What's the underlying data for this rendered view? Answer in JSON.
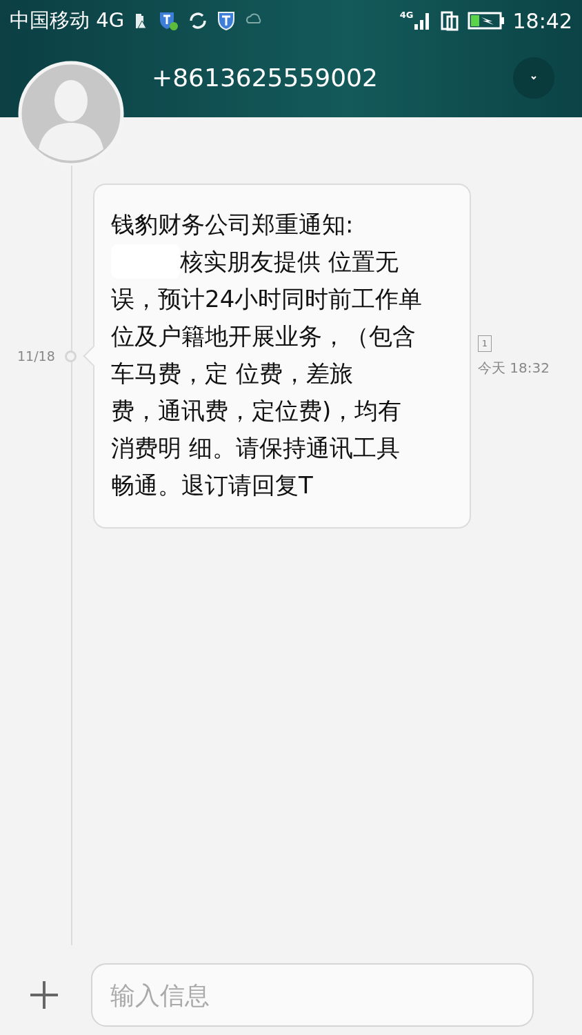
{
  "status_bar": {
    "carrier": "中国移动 4G",
    "network": "4G",
    "time": "18:42"
  },
  "header": {
    "contact": "+8613625559002"
  },
  "thread": {
    "date": "11/18",
    "message": {
      "lines": [
        {
          "text": "钱豹财务公司郑重通知:",
          "redacted": false
        },
        {
          "text": "核实朋友提供 位置无",
          "redacted": true
        },
        {
          "text": "误，预计24小时同时前工作单",
          "redacted": false
        },
        {
          "text": "位及户籍地开展业务，（包含",
          "redacted": false
        },
        {
          "text": "车马费，定 位费，差旅",
          "redacted": false
        },
        {
          "text": "费，通讯费，定位费)，均有",
          "redacted": false
        },
        {
          "text": "消费明 细。请保持通讯工具",
          "redacted": false
        },
        {
          "text": "畅通。退订请回复T",
          "redacted": false
        }
      ],
      "sim": "1",
      "time": "今天 18:32"
    }
  },
  "composer": {
    "placeholder": "输入信息"
  }
}
